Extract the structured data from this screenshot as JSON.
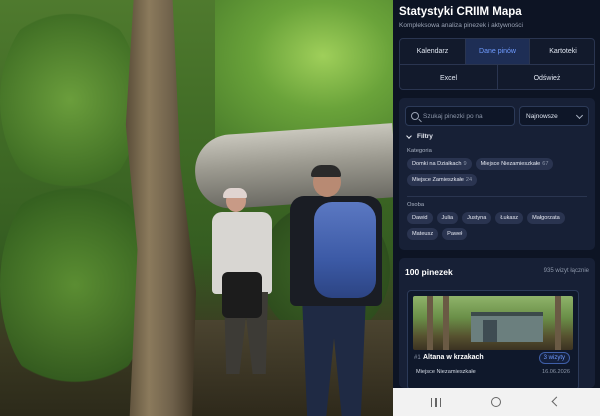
{
  "app": {
    "title": "Statystyki CRIIM Mapa",
    "subtitle": "Kompleksowa analiza pinezek i aktywności"
  },
  "tabs": [
    {
      "label": "Kalendarz",
      "active": false
    },
    {
      "label": "Dane pinów",
      "active": true
    },
    {
      "label": "Kartoteki",
      "active": false
    },
    {
      "label": "Excel",
      "active": false
    },
    {
      "label": "Odśwież",
      "active": false
    }
  ],
  "search": {
    "placeholder": "Szukaj pinezki po na",
    "value": ""
  },
  "sort": {
    "selected": "Najnowsze"
  },
  "filters": {
    "toggle_label": "Filtry",
    "category_label": "Kategoria",
    "categories": [
      {
        "name": "Domki na Działkach",
        "count": "9"
      },
      {
        "name": "Miejsce Niezamieszkałe",
        "count": "67"
      },
      {
        "name": "Miejsce Zamieszkałe",
        "count": "24"
      }
    ],
    "person_label": "Osoba",
    "persons": [
      "Dawid",
      "Julia",
      "Justyna",
      "Łukasz",
      "Małgorzata",
      "Mateusz",
      "Paweł"
    ]
  },
  "list": {
    "title": "100 pinezek",
    "visits_total": "935 wizyt łącznie",
    "items": [
      {
        "number": "#1",
        "name": "Altana w krzakach",
        "visits": "3 wizyty",
        "category": "Miejsce Niezamieszkałe",
        "date": "16.06.2026"
      }
    ]
  },
  "colors": {
    "panel_bg": "#0d1424",
    "card_bg": "#172036",
    "accent": "#6f9bff",
    "active_tab_bg": "#1e2e55"
  },
  "icons": {
    "search": "search-icon",
    "sort_chevron": "chevron-down-icon",
    "filters_chevron": "chevron-down-icon",
    "nav_recents": "recents-icon",
    "nav_home": "home-icon",
    "nav_back": "back-icon"
  }
}
